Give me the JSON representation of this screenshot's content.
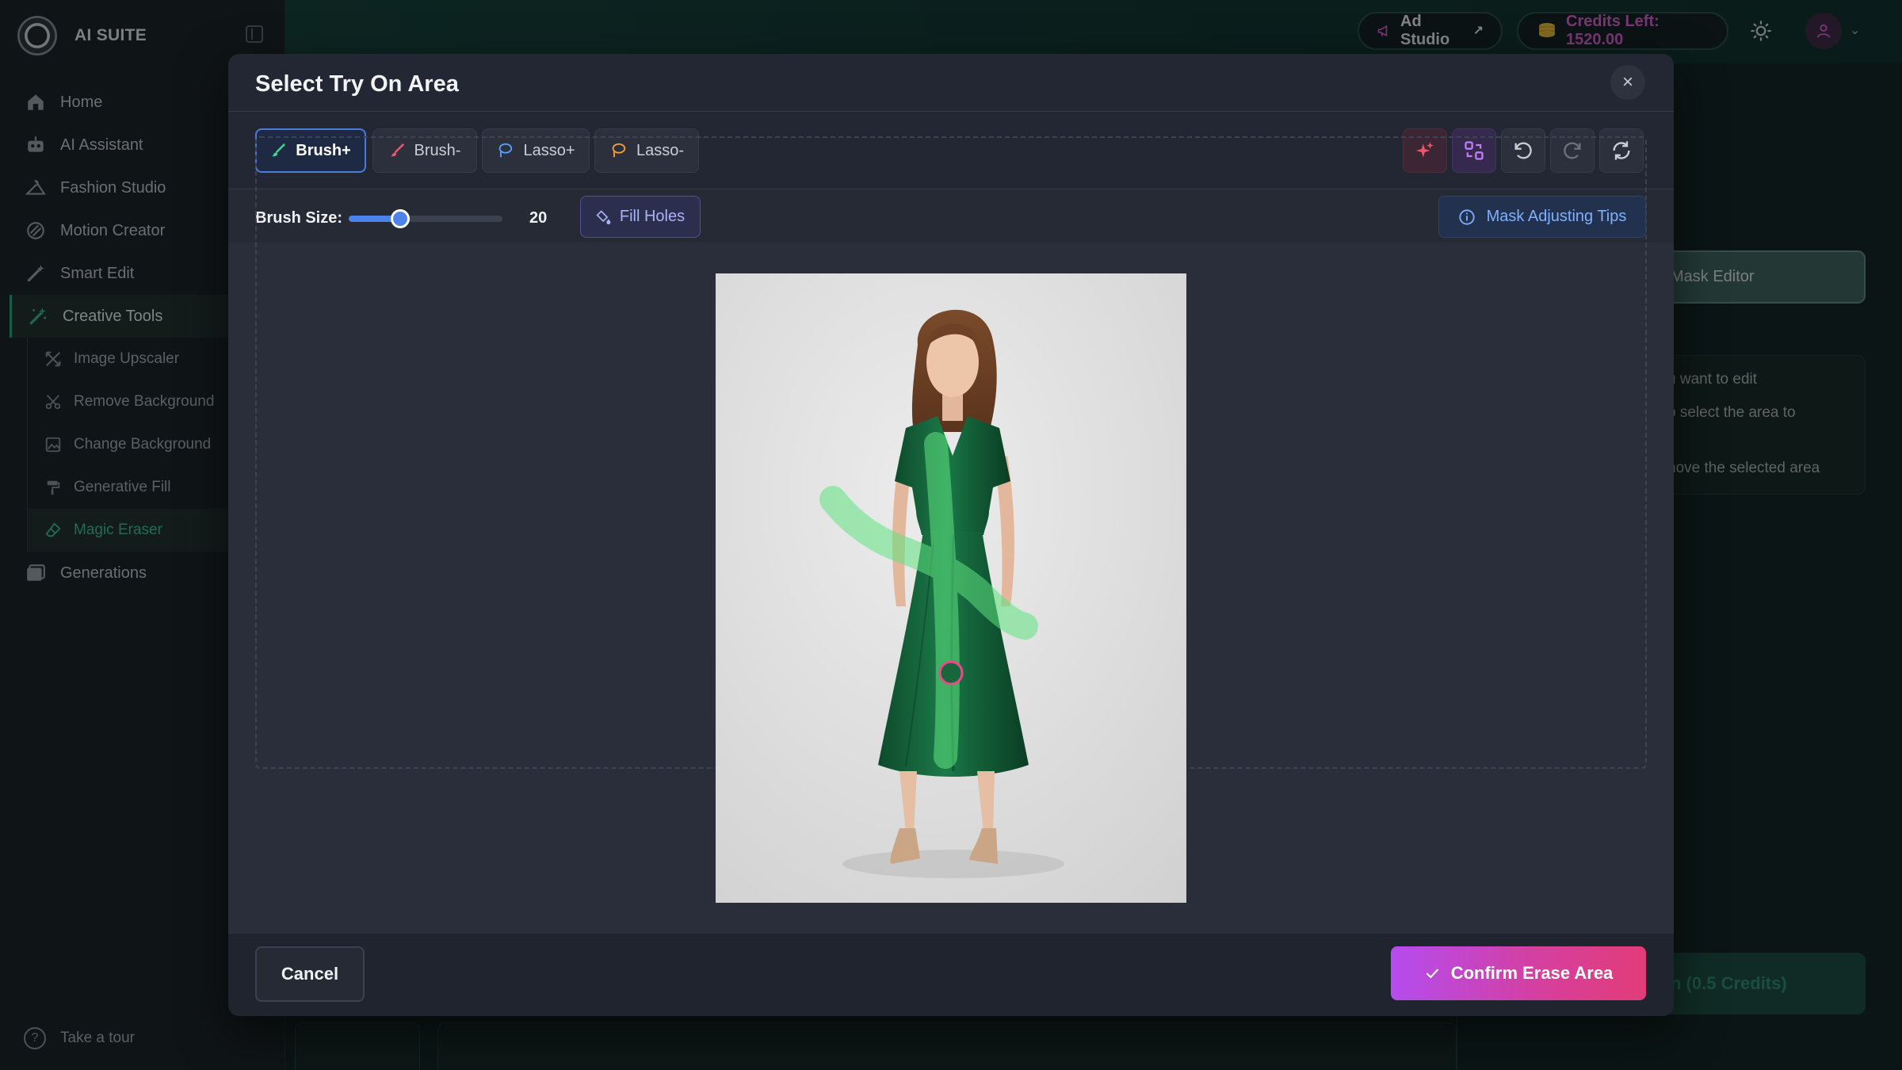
{
  "sidebar": {
    "brand": "AI SUITE",
    "items": [
      {
        "label": "Home",
        "icon": "home-icon"
      },
      {
        "label": "AI Assistant",
        "icon": "robot-icon"
      },
      {
        "label": "Fashion Studio",
        "icon": "hanger-icon"
      },
      {
        "label": "Motion Creator",
        "icon": "motion-icon"
      },
      {
        "label": "Smart Edit",
        "icon": "magic-wand-icon"
      },
      {
        "label": "Creative Tools",
        "icon": "creative-wand-icon"
      }
    ],
    "sub_items": [
      {
        "label": "Image Upscaler",
        "icon": "expand-icon"
      },
      {
        "label": "Remove Background",
        "icon": "scissors-icon"
      },
      {
        "label": "Change Background",
        "icon": "image-icon"
      },
      {
        "label": "Generative Fill",
        "icon": "paint-roller-icon"
      },
      {
        "label": "Magic Eraser",
        "icon": "eraser-icon"
      }
    ],
    "generations": {
      "label": "Generations",
      "icon": "gallery-icon"
    },
    "tour": "Take a tour"
  },
  "topbar": {
    "ad_studio": "Ad Studio",
    "credits": "Credits Left: 1520.00",
    "accent": "#e05cd3"
  },
  "background_panel": {
    "mask_editor": "Mask Editor",
    "line1": "u want to edit",
    "line2": "o select the area to",
    "line3": "nove the selected area",
    "generate": "n (0.5 Credits)"
  },
  "modal": {
    "title": "Select Try On Area",
    "tools": [
      {
        "label": "Brush+",
        "icon": "brush-icon",
        "color": "#3fd68f"
      },
      {
        "label": "Brush-",
        "icon": "brush-icon",
        "color": "#f0566a"
      },
      {
        "label": "Lasso+",
        "icon": "lasso-icon",
        "color": "#5aa0ff"
      },
      {
        "label": "Lasso-",
        "icon": "lasso-icon",
        "color": "#f4a03a"
      }
    ],
    "brush_size_label": "Brush Size:",
    "brush_size": 20,
    "brush_size_max": 60,
    "fill_holes": "Fill Holes",
    "tips": "Mask Adjusting Tips",
    "cancel": "Cancel",
    "confirm": "Confirm Erase Area"
  }
}
